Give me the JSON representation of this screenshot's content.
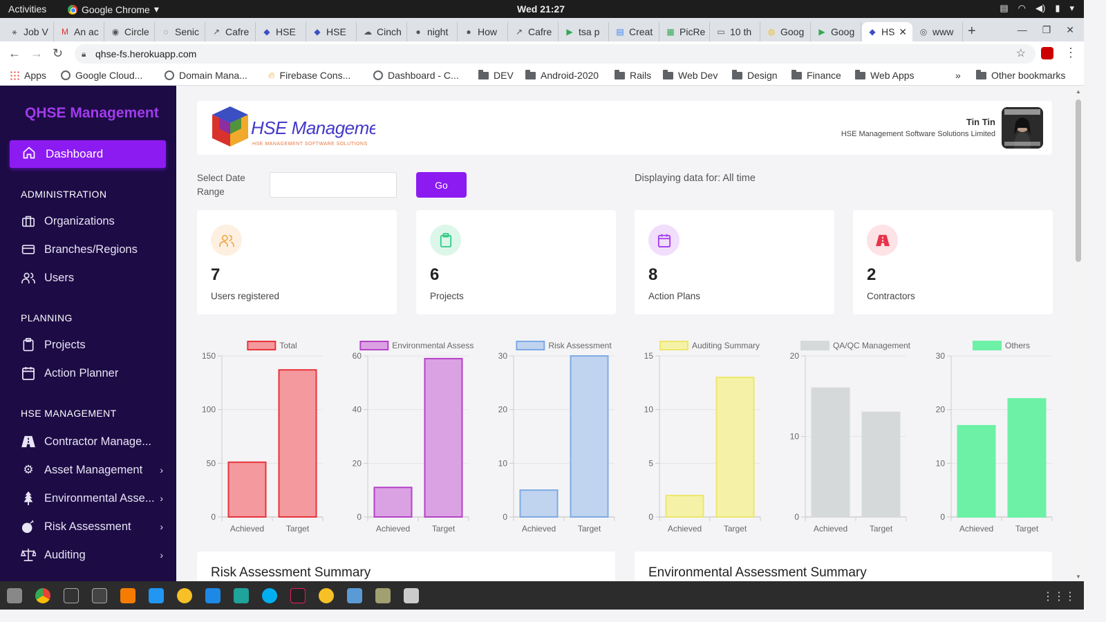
{
  "system": {
    "activities": "Activities",
    "app_menu": "Google Chrome",
    "clock": "Wed 21:27"
  },
  "browser": {
    "tabs": [
      {
        "label": "Job V",
        "icon": "star-icon"
      },
      {
        "label": "An ac",
        "icon": "gmail-icon"
      },
      {
        "label": "Circle",
        "icon": "circleci-icon"
      },
      {
        "label": "Senic",
        "icon": "circle-dashed-icon"
      },
      {
        "label": "Cafre",
        "icon": "arrow-icon"
      },
      {
        "label": "HSE",
        "icon": "hse-icon"
      },
      {
        "label": "HSE",
        "icon": "hse-icon"
      },
      {
        "label": "Cinch",
        "icon": "cloud-icon"
      },
      {
        "label": "night",
        "icon": "github-icon"
      },
      {
        "label": "How",
        "icon": "github-icon"
      },
      {
        "label": "Cafre",
        "icon": "arrow-icon"
      },
      {
        "label": "tsa p",
        "icon": "play-icon"
      },
      {
        "label": "Creat",
        "icon": "doc-icon"
      },
      {
        "label": "PicRe",
        "icon": "grid-icon"
      },
      {
        "label": "10 th",
        "icon": "card-icon"
      },
      {
        "label": "Goog",
        "icon": "bulb-icon"
      },
      {
        "label": "Goog",
        "icon": "play-icon"
      },
      {
        "label": "HS",
        "icon": "hse-icon",
        "active": true
      },
      {
        "label": "www",
        "icon": "globe-icon"
      }
    ],
    "url": "qhse-fs.herokuapp.com",
    "bookmarks": [
      {
        "label": "Apps",
        "icon": "apps-grid-icon"
      },
      {
        "label": "Google Cloud...",
        "icon": "globe-icon"
      },
      {
        "label": "Domain Mana...",
        "icon": "globe-icon"
      },
      {
        "label": "Firebase Cons...",
        "icon": "firebase-icon"
      },
      {
        "label": "Dashboard - C...",
        "icon": "globe-icon"
      },
      {
        "label": "DEV",
        "icon": "folder-icon"
      },
      {
        "label": "Android-2020",
        "icon": "folder-icon"
      },
      {
        "label": "Rails",
        "icon": "folder-icon"
      },
      {
        "label": "Web Dev",
        "icon": "folder-icon"
      },
      {
        "label": "Design",
        "icon": "folder-icon"
      },
      {
        "label": "Finance",
        "icon": "folder-icon"
      },
      {
        "label": "Web Apps",
        "icon": "folder-icon"
      }
    ],
    "overflow": "»",
    "other_bookmarks": "Other bookmarks"
  },
  "sidebar": {
    "brand": "QHSE Management",
    "dashboard": "Dashboard",
    "sections": {
      "admin": "ADMINISTRATION",
      "planning": "PLANNING",
      "hse": "HSE MANAGEMENT"
    },
    "items": {
      "organizations": "Organizations",
      "branches": "Branches/Regions",
      "users": "Users",
      "projects": "Projects",
      "action_planner": "Action Planner",
      "contractor": "Contractor Manage...",
      "asset": "Asset Management",
      "environmental": "Environmental Asse...",
      "risk": "Risk Assessment",
      "auditing": "Auditing"
    }
  },
  "header": {
    "logo_title": "HSE Management",
    "logo_sub": "HSE MANAGEMENT SOFTWARE SOLUTIONS",
    "user_name": "Tin Tin",
    "company": "HSE Management Software Solutions Limited"
  },
  "filter": {
    "label": "Select Date Range",
    "input_value": "",
    "go": "Go",
    "displaying": "Displaying data for: All time"
  },
  "stats": [
    {
      "value": "7",
      "label": "Users registered",
      "icon": "users-icon",
      "bg": "#fdf0e0",
      "fg": "#f0a547"
    },
    {
      "value": "6",
      "label": "Projects",
      "icon": "clipboard-icon",
      "bg": "#dcf7ea",
      "fg": "#2ecb85"
    },
    {
      "value": "8",
      "label": "Action Plans",
      "icon": "calendar-icon",
      "bg": "#f1defb",
      "fg": "#a23bec"
    },
    {
      "value": "2",
      "label": "Contractors",
      "icon": "road-icon",
      "bg": "#fde2e6",
      "fg": "#e8334a"
    }
  ],
  "colors": {
    "accent": "#8c1bf2",
    "sidebar_bg": "#1c0b45",
    "brand": "#a23bec"
  },
  "chart_data": [
    {
      "type": "bar",
      "title": "",
      "legend": "Total",
      "categories": [
        "Achieved",
        "Target"
      ],
      "values": [
        51,
        137
      ],
      "ylim": [
        0,
        150
      ],
      "yticks": [
        0,
        50,
        100,
        150
      ],
      "fill": "#f4999d",
      "stroke": "#e8343b"
    },
    {
      "type": "bar",
      "title": "",
      "legend": "Environmental Assess.",
      "categories": [
        "Achieved",
        "Target"
      ],
      "values": [
        11,
        59
      ],
      "ylim": [
        0,
        60
      ],
      "yticks": [
        0,
        20,
        40,
        60
      ],
      "fill": "#dba2e3",
      "stroke": "#b542c8"
    },
    {
      "type": "bar",
      "title": "",
      "legend": "Risk Assessment",
      "categories": [
        "Achieved",
        "Target"
      ],
      "values": [
        5,
        30
      ],
      "ylim": [
        0,
        30
      ],
      "yticks": [
        0,
        10,
        20,
        30
      ],
      "fill": "#c0d4f0",
      "stroke": "#7eaae4"
    },
    {
      "type": "bar",
      "title": "",
      "legend": "Auditing Summary",
      "categories": [
        "Achieved",
        "Target"
      ],
      "values": [
        2,
        13
      ],
      "ylim": [
        0,
        15
      ],
      "yticks": [
        0,
        5,
        10,
        15
      ],
      "fill": "#f5f2a8",
      "stroke": "#ece76a"
    },
    {
      "type": "bar",
      "title": "",
      "legend": "QA/QC Management",
      "categories": [
        "Achieved",
        "Target"
      ],
      "values": [
        16,
        13
      ],
      "ylim": [
        0,
        20
      ],
      "yticks": [
        0,
        10,
        20
      ],
      "fill": "#d6d9d9",
      "stroke": "#d6d9d9"
    },
    {
      "type": "bar",
      "title": "",
      "legend": "Others",
      "categories": [
        "Achieved",
        "Target"
      ],
      "values": [
        17,
        22
      ],
      "ylim": [
        0,
        30
      ],
      "yticks": [
        0,
        10,
        20,
        30
      ],
      "fill": "#6cf1a6",
      "stroke": "#6cf1a6"
    }
  ],
  "summaries": {
    "risk": "Risk Assessment Summary",
    "environmental": "Environmental Assessment Summary"
  }
}
